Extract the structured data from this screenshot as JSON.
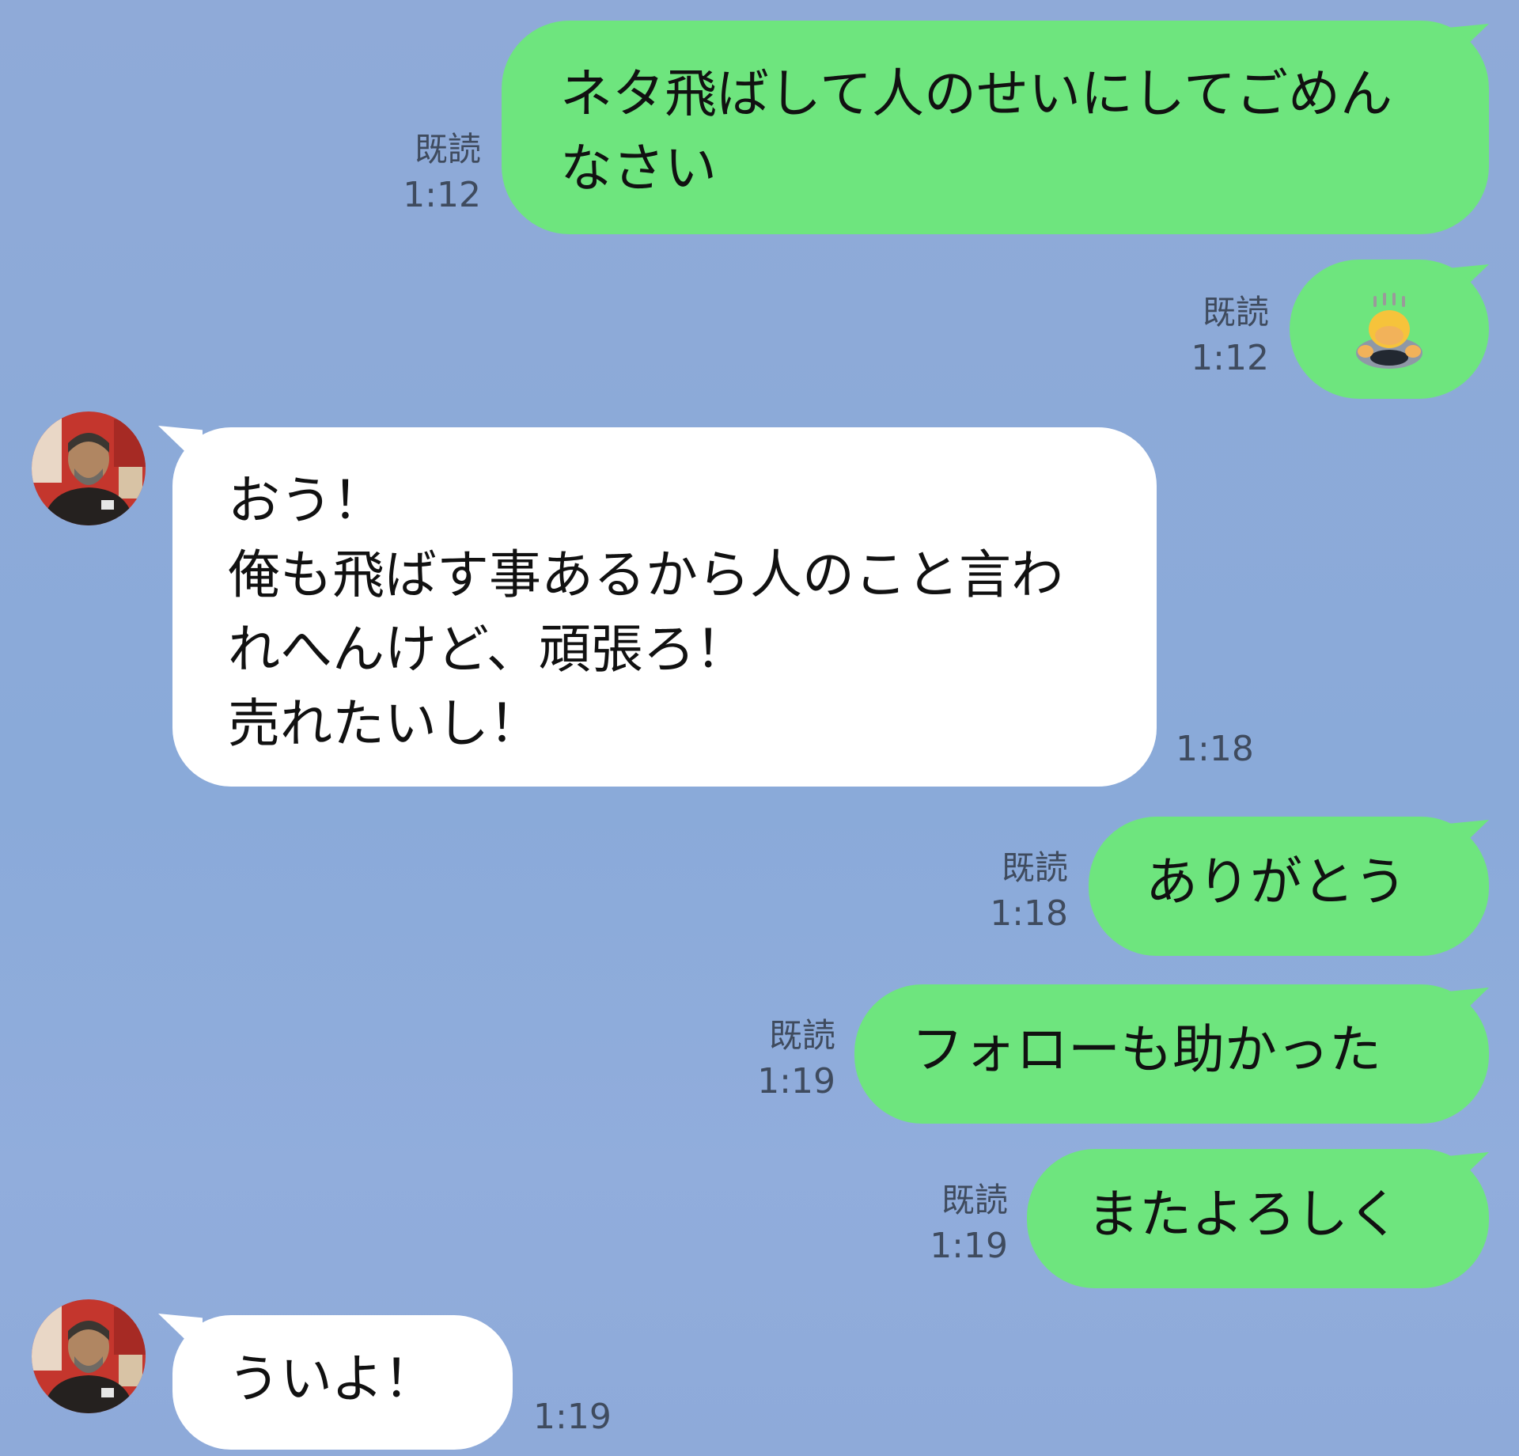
{
  "colors": {
    "background": "#8aaad9",
    "my_bubble": "#6ee57e",
    "their_bubble": "#ffffff",
    "meta_text": "#3f4b5e"
  },
  "messages": [
    {
      "from": "me",
      "text": "ネタ飛ばして人のせいにしてごめんなさい",
      "read": "既読",
      "time": "1:12"
    },
    {
      "from": "me",
      "emoji": "person-bowing-emoji",
      "read": "既読",
      "time": "1:12"
    },
    {
      "from": "other",
      "text": "おう！\n俺も飛ばす事あるから人のこと言われへんけど、頑張ろ！\n売れたいし！",
      "time": "1:18"
    },
    {
      "from": "me",
      "text": "ありがとう",
      "read": "既読",
      "time": "1:18"
    },
    {
      "from": "me",
      "text": "フォローも助かった",
      "read": "既読",
      "time": "1:19"
    },
    {
      "from": "me",
      "text": "またよろしく",
      "read": "既読",
      "time": "1:19"
    },
    {
      "from": "other",
      "text": "ういよ！",
      "time": "1:19"
    }
  ]
}
